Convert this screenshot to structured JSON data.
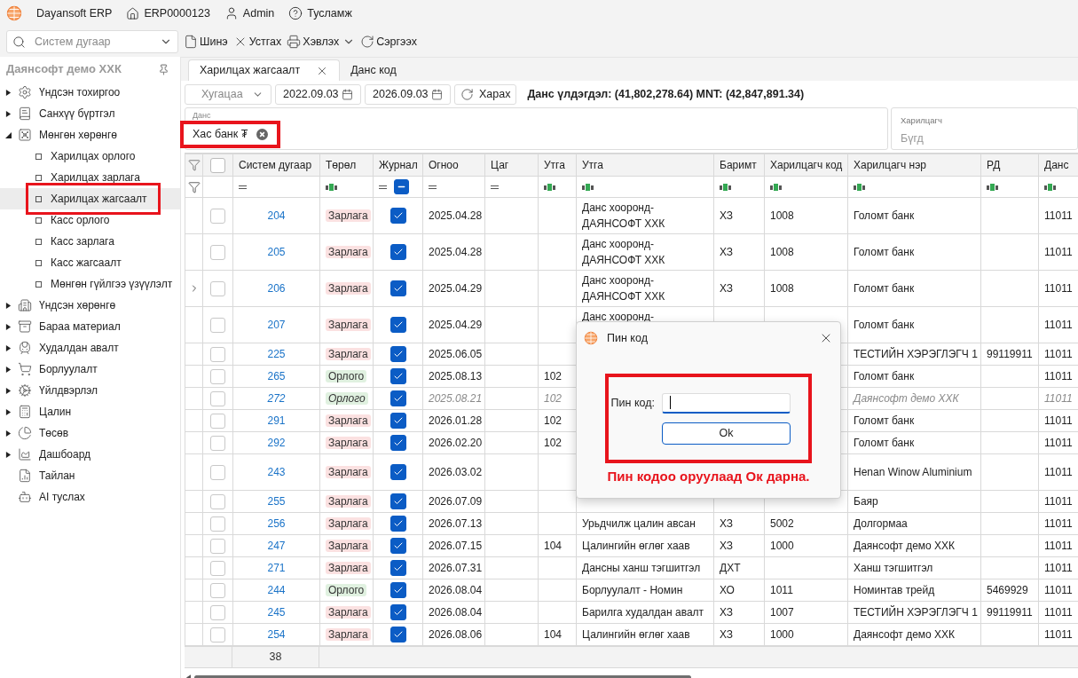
{
  "app_bar": {
    "title": "Dayansoft ERP",
    "company_code": "ERP0000123",
    "user": "Admin",
    "help": "Тусламж"
  },
  "toolbar": {
    "search": {
      "placeholder": "Систем дугаар"
    },
    "buttons": [
      {
        "label": "Шинэ",
        "kind": "new"
      },
      {
        "label": "Устгах",
        "kind": "delete"
      },
      {
        "label": "Хэвлэх",
        "kind": "print"
      },
      {
        "label": "Сэргээх",
        "kind": "refresh"
      }
    ]
  },
  "sidebar": {
    "title": "Даянсофт демо ХХК",
    "items": [
      {
        "label": "Үндсэн тохиргоо",
        "kind": "folder",
        "expanded": false,
        "selected": false
      },
      {
        "label": "Санхүү бүртгэл",
        "kind": "folder",
        "expanded": false,
        "selected": false
      },
      {
        "label": "Мөнгөн хөрөнгө",
        "kind": "folder",
        "expanded": true,
        "selected": false,
        "children": [
          {
            "label": "Харилцах орлого",
            "selected": false,
            "highlighted": false
          },
          {
            "label": "Харилцах зарлага",
            "selected": false,
            "highlighted": false
          },
          {
            "label": "Харилцах жагсаалт",
            "selected": true,
            "highlighted": true
          },
          {
            "label": "Касс орлого",
            "selected": false,
            "highlighted": false
          },
          {
            "label": "Касс зарлага",
            "selected": false,
            "highlighted": false
          },
          {
            "label": "Касс жагсаалт",
            "selected": false,
            "highlighted": false
          },
          {
            "label": "Мөнгөн гүйлгээ үзүүлэлт",
            "selected": false,
            "highlighted": false
          }
        ]
      },
      {
        "label": "Үндсэн хөрөнгө",
        "kind": "folder",
        "expanded": false,
        "selected": false
      },
      {
        "label": "Бараа материал",
        "kind": "folder",
        "expanded": false,
        "selected": false
      },
      {
        "label": "Худалдан авалт",
        "kind": "folder",
        "expanded": false,
        "selected": false
      },
      {
        "label": "Борлуулалт",
        "kind": "folder",
        "expanded": false,
        "selected": false
      },
      {
        "label": "Үйлдвэрлэл",
        "kind": "folder",
        "expanded": false,
        "selected": false
      },
      {
        "label": "Цалин",
        "kind": "folder",
        "expanded": false,
        "selected": false
      },
      {
        "label": "Төсөв",
        "kind": "folder",
        "expanded": false,
        "selected": false
      },
      {
        "label": "Дашбоард",
        "kind": "folder",
        "expanded": false,
        "selected": false
      },
      {
        "label": "Тайлан",
        "kind": "item",
        "selected": false
      },
      {
        "label": "AI туслах",
        "kind": "item",
        "selected": false
      }
    ]
  },
  "tabs": [
    {
      "label": "Харилцах жагсаалт",
      "selected": true
    },
    {
      "label": "Данс код",
      "selected": false
    }
  ],
  "filters": {
    "period": {
      "placeholder": "Хугацаа"
    },
    "date_from": "2022.09.03",
    "date_to": "2026.09.03",
    "view_button": "Харах",
    "balance": "Данс үлдэгдэл: (41,802,278.64) MNT: (42,847,891.34)",
    "account": {
      "label": "Данс",
      "chip": "Хас банк ₮",
      "highlighted": true
    },
    "partner": {
      "label": "Харилцагч",
      "placeholder": "Бүгд"
    }
  },
  "table": {
    "header_checked": false,
    "columns": [
      {
        "label": "Систем дугаар",
        "filter": {
          "kind": "equals"
        }
      },
      {
        "label": "Төрөл",
        "filter": {
          "kind": "text"
        }
      },
      {
        "label": "Журнал",
        "filter": {
          "kind": "equals"
        },
        "filter_indeterminate": true
      },
      {
        "label": "Огноо",
        "filter": {
          "kind": "equals"
        }
      },
      {
        "label": "Цаг",
        "filter": {
          "kind": "equals"
        }
      },
      {
        "label": "Утга",
        "filter": {
          "kind": "text"
        }
      },
      {
        "label": "Утга",
        "filter": {
          "kind": "text"
        }
      },
      {
        "label": "Баримт",
        "filter": {
          "kind": "text"
        }
      },
      {
        "label": "Харилцагч код",
        "filter": {
          "kind": "text"
        }
      },
      {
        "label": "Харилцагч нэр",
        "filter": {
          "kind": "text"
        }
      },
      {
        "label": "РД",
        "filter": {
          "kind": "text"
        }
      },
      {
        "label": "Данс",
        "filter": {
          "kind": "text"
        }
      }
    ],
    "rows": [
      {
        "selected": false,
        "expandable": false,
        "muted": false,
        "tall": true,
        "system_no": "204",
        "type": {
          "label": "Зарлага",
          "kind": "expense"
        },
        "journal": true,
        "date": "2025.04.28",
        "description": "Данс хооронд-ДАЯНСОФТ ХХК",
        "document": "ХЗ",
        "partner_code": "1008",
        "partner_name": "Голомт банк",
        "account": "11011"
      },
      {
        "selected": false,
        "expandable": false,
        "muted": false,
        "tall": true,
        "system_no": "205",
        "type": {
          "label": "Зарлага",
          "kind": "expense"
        },
        "journal": true,
        "date": "2025.04.28",
        "description": "Данс хооронд-ДАЯНСОФТ ХХК",
        "document": "ХЗ",
        "partner_code": "1008",
        "partner_name": "Голомт банк",
        "account": "11011"
      },
      {
        "selected": false,
        "expandable": true,
        "muted": false,
        "tall": true,
        "system_no": "206",
        "type": {
          "label": "Зарлага",
          "kind": "expense"
        },
        "journal": true,
        "date": "2025.04.29",
        "description": "Данс хооронд-ДАЯНСОФТ ХХК",
        "document": "ХЗ",
        "partner_code": "1008",
        "partner_name": "Голомт банк",
        "account": "11011"
      },
      {
        "selected": false,
        "expandable": false,
        "muted": false,
        "tall": true,
        "system_no": "207",
        "type": {
          "label": "Зарлага",
          "kind": "expense"
        },
        "journal": true,
        "date": "2025.04.29",
        "description": "Данс хооронд-",
        "partner_name": "Голомт банк",
        "account": "11011"
      },
      {
        "selected": false,
        "expandable": false,
        "muted": false,
        "tall": false,
        "system_no": "225",
        "type": {
          "label": "Зарлага",
          "kind": "expense"
        },
        "journal": true,
        "date": "2025.06.05",
        "partner_name": "ТЕСТИЙН ХЭРЭГЛЭГЧ 1",
        "rd": "99119911",
        "account": "11011"
      },
      {
        "selected": false,
        "expandable": false,
        "muted": false,
        "tall": false,
        "system_no": "265",
        "type": {
          "label": "Орлого",
          "kind": "income"
        },
        "journal": true,
        "date": "2025.08.13",
        "amount": "102",
        "partner_name": "Голомт банк",
        "account": "11011"
      },
      {
        "selected": false,
        "expandable": false,
        "muted": true,
        "tall": false,
        "system_no": "272",
        "type": {
          "label": "Орлого",
          "kind": "income"
        },
        "journal": true,
        "date": "2025.08.21",
        "amount": "102",
        "partner_name": "Даянсофт демо ХХК",
        "account": "11011"
      },
      {
        "selected": false,
        "expandable": false,
        "muted": false,
        "tall": false,
        "system_no": "291",
        "type": {
          "label": "Зарлага",
          "kind": "expense"
        },
        "journal": true,
        "date": "2026.01.28",
        "amount": "102",
        "partner_name": "Голомт банк",
        "account": "11011"
      },
      {
        "selected": false,
        "expandable": false,
        "muted": false,
        "tall": false,
        "system_no": "292",
        "type": {
          "label": "Зарлага",
          "kind": "expense"
        },
        "journal": true,
        "date": "2026.02.20",
        "amount": "102",
        "partner_name": "Голомт банк",
        "account": "11011"
      },
      {
        "selected": false,
        "expandable": false,
        "muted": false,
        "tall": true,
        "system_no": "243",
        "type": {
          "label": "Зарлага",
          "kind": "expense"
        },
        "journal": true,
        "date": "2026.03.02",
        "partner_name": "Henan Winow Aluminium",
        "account": "11011"
      },
      {
        "selected": false,
        "expandable": false,
        "muted": false,
        "tall": false,
        "system_no": "255",
        "type": {
          "label": "Зарлага",
          "kind": "expense"
        },
        "journal": true,
        "date": "2026.07.09",
        "partner_name": "Баяр",
        "account": "11011"
      },
      {
        "selected": false,
        "expandable": false,
        "muted": false,
        "tall": false,
        "system_no": "256",
        "type": {
          "label": "Зарлага",
          "kind": "expense"
        },
        "journal": true,
        "date": "2026.07.13",
        "description": "Урьдчилж цалин авсан",
        "document": "ХЗ",
        "partner_code": "5002",
        "partner_name": "Долгормаа",
        "account": "11011"
      },
      {
        "selected": false,
        "expandable": false,
        "muted": false,
        "tall": false,
        "system_no": "247",
        "type": {
          "label": "Зарлага",
          "kind": "expense"
        },
        "journal": true,
        "date": "2026.07.15",
        "amount": "104",
        "description": "Цалингийн өглөг хаав",
        "document": "ХЗ",
        "partner_code": "1000",
        "partner_name": "Даянсофт демо ХХК",
        "account": "11011"
      },
      {
        "selected": false,
        "expandable": false,
        "muted": false,
        "tall": false,
        "system_no": "271",
        "type": {
          "label": "Зарлага",
          "kind": "expense"
        },
        "journal": true,
        "date": "2026.07.31",
        "description": "Дансны ханш тэгшитгэл",
        "document": "ДХТ",
        "partner_name": "Ханш тэгшитгэл",
        "account": "11011"
      },
      {
        "selected": false,
        "expandable": false,
        "muted": false,
        "tall": false,
        "system_no": "244",
        "type": {
          "label": "Орлого",
          "kind": "income"
        },
        "journal": true,
        "date": "2026.08.04",
        "description": "Борлуулалт - Номин",
        "document": "ХО",
        "partner_code": "1011",
        "partner_name": "Номинтав трейд",
        "rd": "5469929",
        "account": "11011"
      },
      {
        "selected": false,
        "expandable": false,
        "muted": false,
        "tall": false,
        "system_no": "245",
        "type": {
          "label": "Зарлага",
          "kind": "expense"
        },
        "journal": true,
        "date": "2026.08.04",
        "description": "Барилга худалдан авалт",
        "document": "ХЗ",
        "partner_code": "1007",
        "partner_name": "ТЕСТИЙН ХЭРЭГЛЭГЧ 1",
        "rd": "99119911",
        "account": "11011"
      },
      {
        "selected": false,
        "expandable": false,
        "muted": false,
        "tall": false,
        "system_no": "254",
        "type": {
          "label": "Зарлага",
          "kind": "expense"
        },
        "journal": true,
        "date": "2026.08.06",
        "amount": "104",
        "description": "Цалингийн өглөг хаав",
        "document": "ХЗ",
        "partner_code": "1000",
        "partner_name": "Даянсофт демо ХХК",
        "account": "11011"
      }
    ],
    "footer_count": "38"
  },
  "dialog": {
    "title": "Пин код",
    "field_label": "Пин код:",
    "ok_button": "Ok",
    "highlighted": true,
    "note": "Пин кодоо оруулаад Ок дарна."
  }
}
